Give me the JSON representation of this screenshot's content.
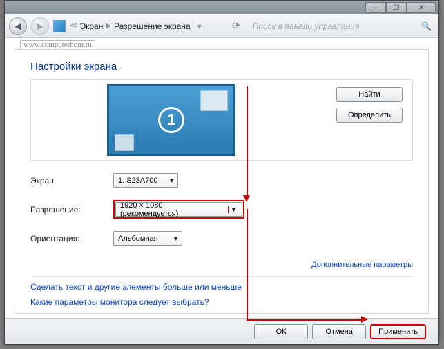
{
  "titlebar": {
    "min": "—",
    "max": "☐",
    "close": "✕"
  },
  "nav": {
    "back": "◀",
    "fwd": "▶",
    "bc_parent": "Экран",
    "bc_current": "Разрешение экрана",
    "search_placeholder": "Поиск в панели управления"
  },
  "watermark": "www.computerhom.ru",
  "heading": "Настройки экрана",
  "monitor_number": "1",
  "buttons": {
    "find": "Найти",
    "detect": "Определить"
  },
  "fields": {
    "screen_label": "Экран:",
    "screen_value": "1. S23A700",
    "resolution_label": "Разрешение:",
    "resolution_value": "1920 × 1080 (рекомендуется)",
    "orientation_label": "Ориентация:",
    "orientation_value": "Альбомная"
  },
  "links": {
    "advanced": "Дополнительные параметры",
    "bigger": "Сделать текст и другие элементы больше или меньше",
    "which": "Какие параметры монитора следует выбрать?"
  },
  "footer": {
    "ok": "ОК",
    "cancel": "Отмена",
    "apply": "Применить"
  }
}
